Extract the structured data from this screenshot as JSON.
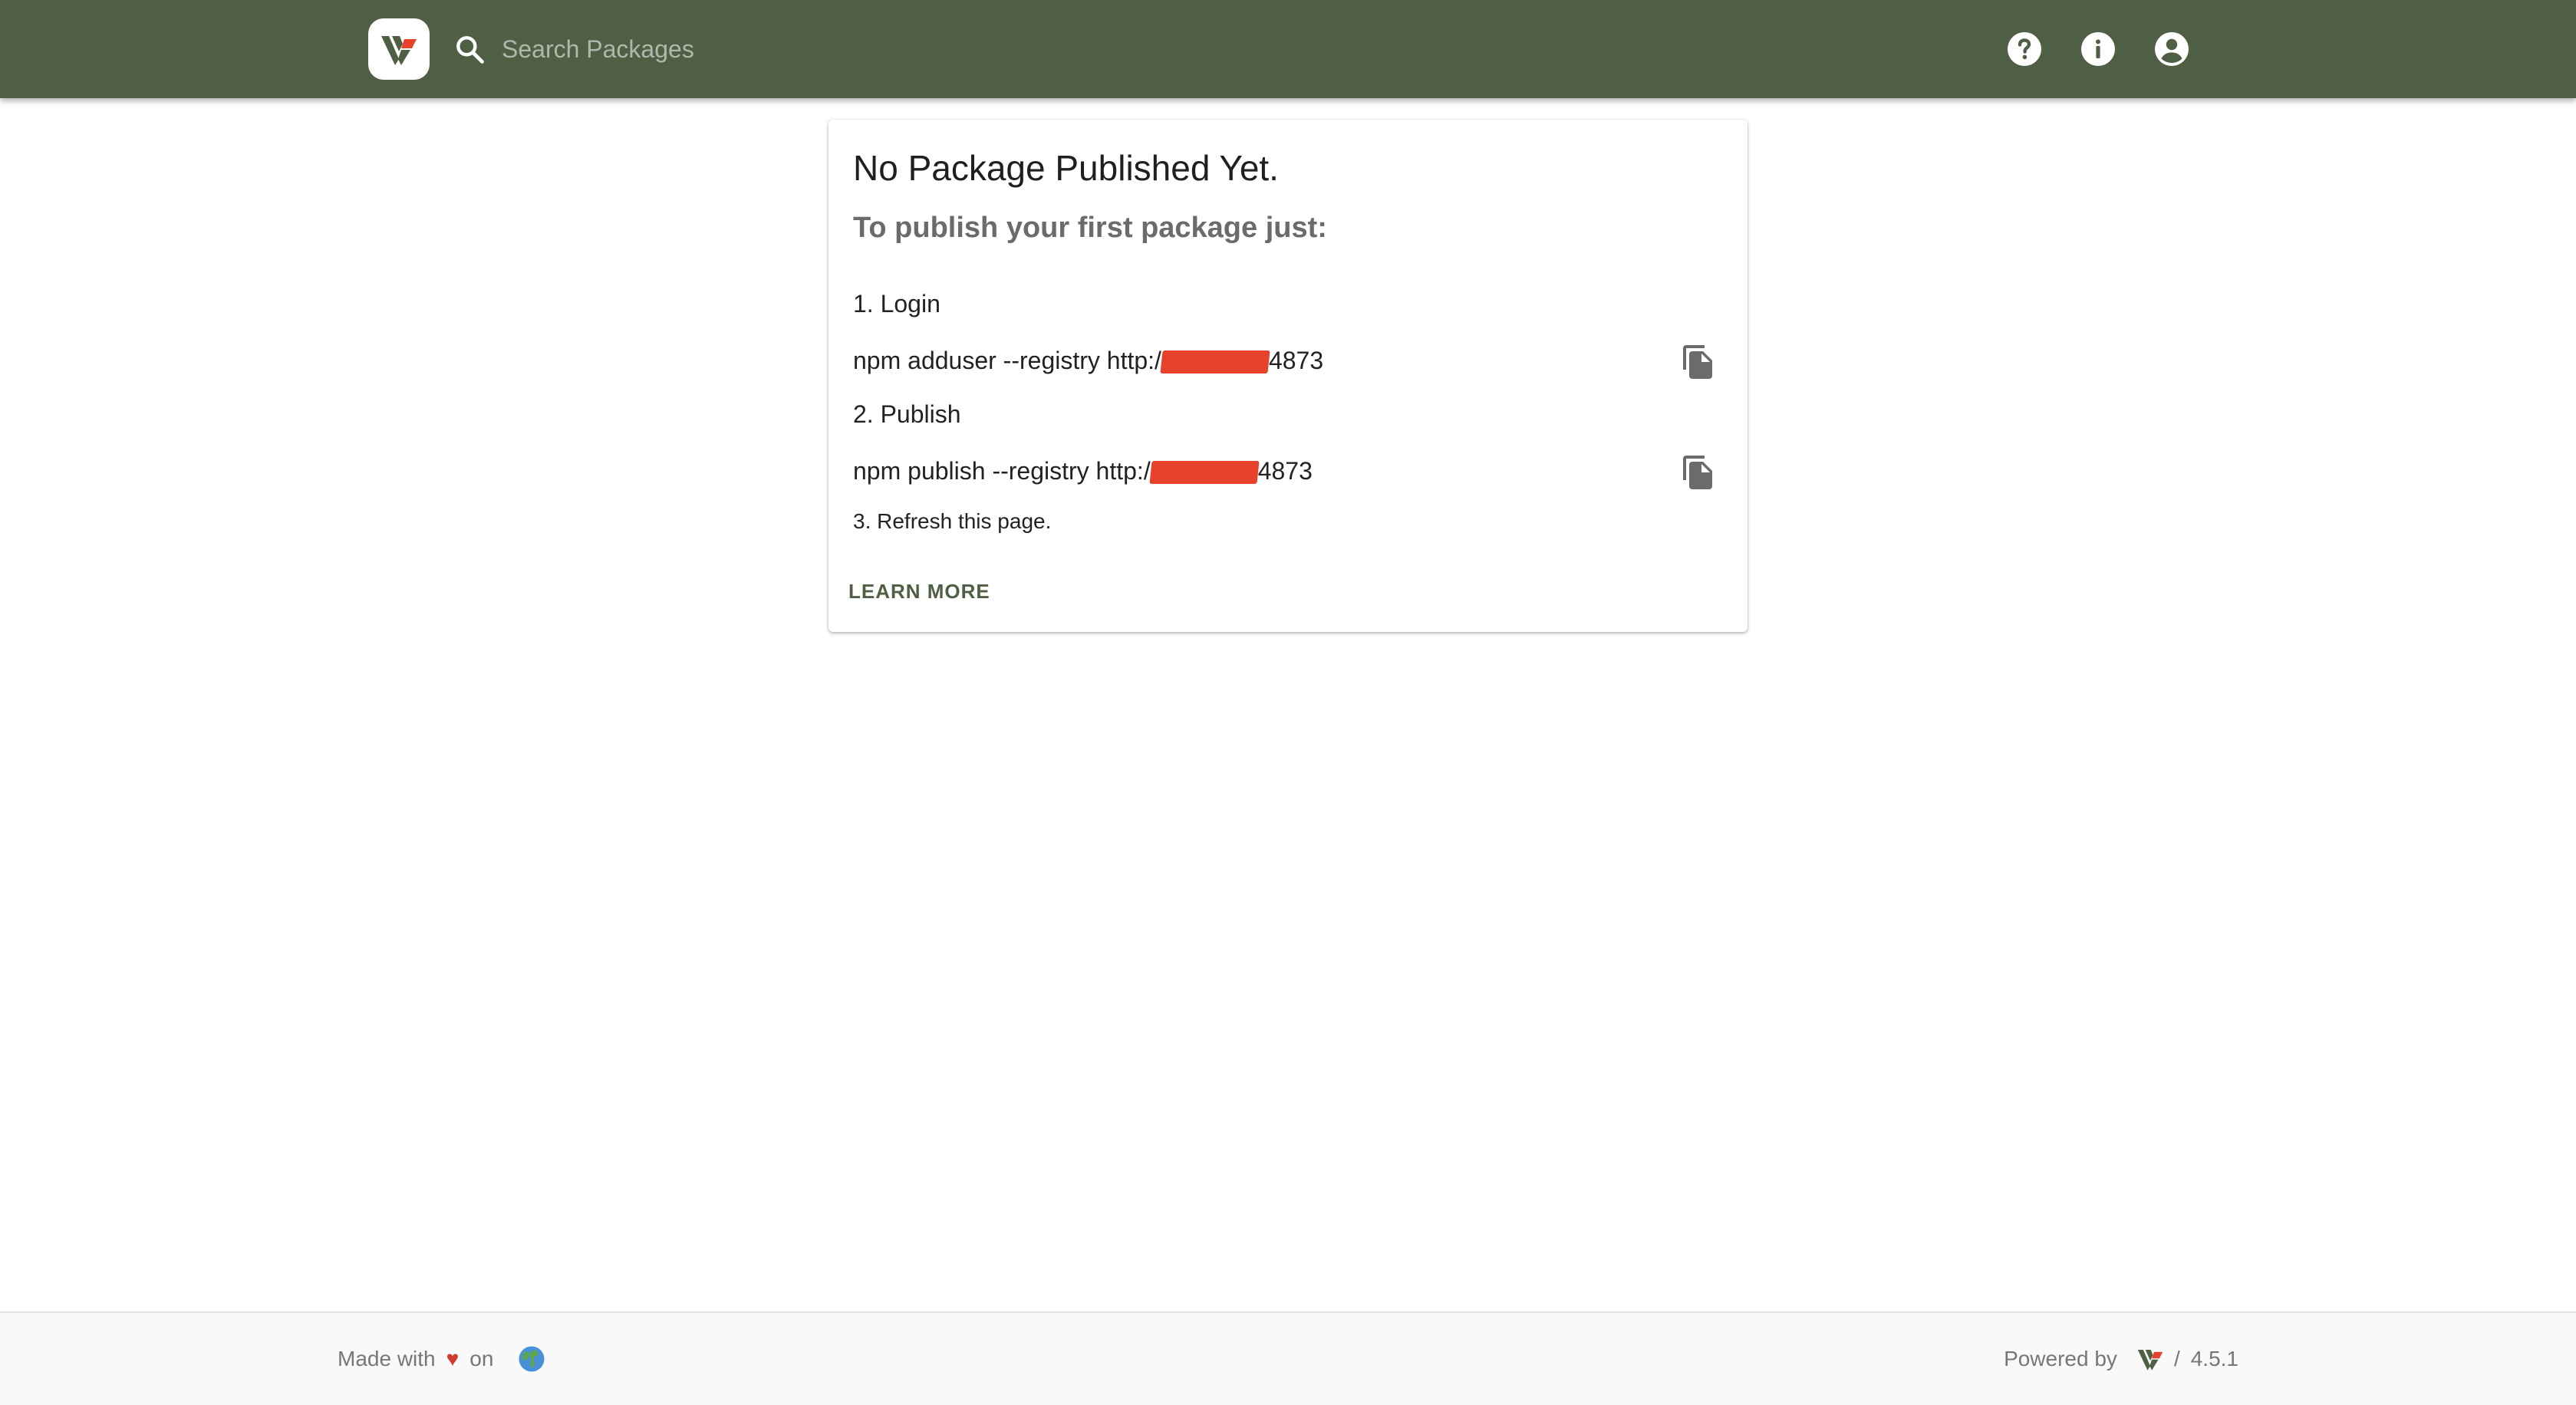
{
  "header": {
    "search_placeholder": "Search Packages",
    "bg_color": "#4f5f43",
    "icons": [
      "help-icon",
      "info-icon",
      "account-icon"
    ]
  },
  "card": {
    "title": "No Package Published Yet.",
    "subtitle": "To publish your first package just:",
    "steps": [
      {
        "label": "1. Login",
        "command_prefix": "npm adduser --registry http:/",
        "command_suffix": "4873"
      },
      {
        "label": "2. Publish",
        "command_prefix": "npm publish --registry http:/",
        "command_suffix": "4873"
      }
    ],
    "refresh_label": "3. Refresh this page.",
    "learn_more": "LEARN MORE"
  },
  "footer": {
    "made_with": "Made with",
    "heart": "♥",
    "on": "on",
    "powered_by": "Powered by",
    "separator": "/",
    "version": "4.5.1"
  },
  "colors": {
    "brand": "#4f5f43",
    "redaction": "#e8412b",
    "heart": "#d23a2e"
  }
}
